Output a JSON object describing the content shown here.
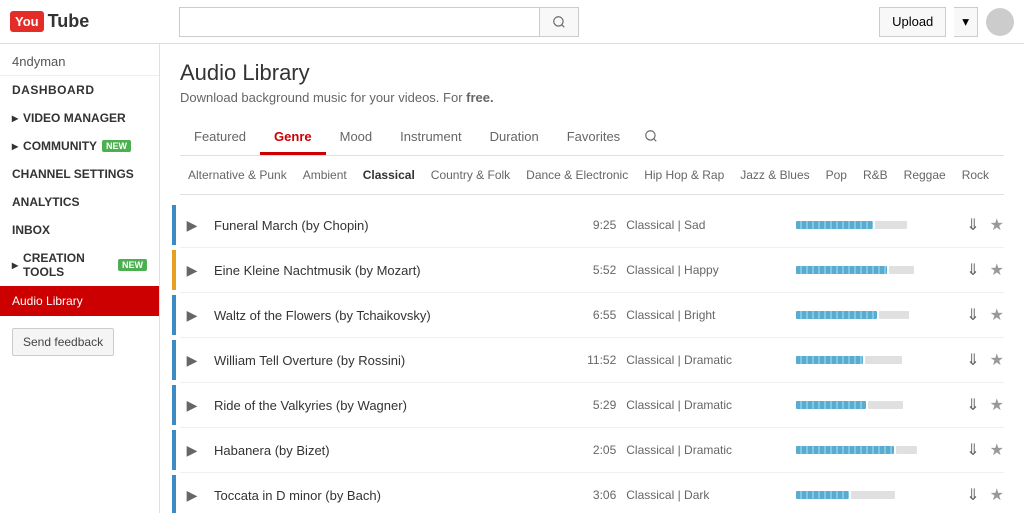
{
  "header": {
    "logo_box": "You",
    "logo_tube": "Tube",
    "search_placeholder": "",
    "upload_label": "Upload",
    "account_icon": "▾"
  },
  "sidebar": {
    "username": "4ndyman",
    "dashboard_label": "DASHBOARD",
    "items": [
      {
        "id": "video-manager",
        "label": "VIDEO MANAGER",
        "arrow": "▸"
      },
      {
        "id": "community",
        "label": "COMMUNITY",
        "badge": "NEW",
        "arrow": "▸"
      },
      {
        "id": "channel-settings",
        "label": "CHANNEL SETTINGS"
      },
      {
        "id": "analytics",
        "label": "ANALYTICS"
      },
      {
        "id": "inbox",
        "label": "INBOX"
      },
      {
        "id": "creation-tools",
        "label": "CREATION TOOLS",
        "badge": "NEW",
        "arrow": "▸"
      },
      {
        "id": "audio-library",
        "label": "Audio Library",
        "active": true
      }
    ],
    "feedback_label": "Send feedback"
  },
  "main": {
    "title": "Audio Library",
    "subtitle_text": "Download background music for your videos. For",
    "subtitle_free": "free.",
    "tabs_primary": [
      {
        "id": "featured",
        "label": "Featured"
      },
      {
        "id": "genre",
        "label": "Genre",
        "active": true
      },
      {
        "id": "mood",
        "label": "Mood"
      },
      {
        "id": "instrument",
        "label": "Instrument"
      },
      {
        "id": "duration",
        "label": "Duration"
      },
      {
        "id": "favorites",
        "label": "Favorites"
      }
    ],
    "genre_tabs": [
      {
        "id": "alt-punk",
        "label": "Alternative & Punk"
      },
      {
        "id": "ambient",
        "label": "Ambient"
      },
      {
        "id": "classical",
        "label": "Classical",
        "active": true
      },
      {
        "id": "country",
        "label": "Country & Folk"
      },
      {
        "id": "dance",
        "label": "Dance & Electronic"
      },
      {
        "id": "hiphop",
        "label": "Hip Hop & Rap"
      },
      {
        "id": "jazz",
        "label": "Jazz & Blues"
      },
      {
        "id": "pop",
        "label": "Pop"
      },
      {
        "id": "rnb",
        "label": "R&B"
      },
      {
        "id": "reggae",
        "label": "Reggae"
      },
      {
        "id": "rock",
        "label": "Rock"
      }
    ],
    "tracks": [
      {
        "id": 1,
        "title": "Funeral March (by Chopin)",
        "duration": "9:25",
        "genre": "Classical | Sad",
        "bar_pct": 55,
        "indicator": "blue",
        "starred": false
      },
      {
        "id": 2,
        "title": "Eine Kleine Nachtmusik (by Mozart)",
        "duration": "5:52",
        "genre": "Classical | Happy",
        "bar_pct": 65,
        "indicator": "orange",
        "starred": false
      },
      {
        "id": 3,
        "title": "Waltz of the Flowers (by Tchaikovsky)",
        "duration": "6:55",
        "genre": "Classical | Bright",
        "bar_pct": 58,
        "indicator": "blue",
        "starred": false
      },
      {
        "id": 4,
        "title": "William Tell Overture (by Rossini)",
        "duration": "11:52",
        "genre": "Classical | Dramatic",
        "bar_pct": 48,
        "indicator": "blue",
        "starred": false
      },
      {
        "id": 5,
        "title": "Ride of the Valkyries (by Wagner)",
        "duration": "5:29",
        "genre": "Classical | Dramatic",
        "bar_pct": 50,
        "indicator": "blue",
        "starred": false
      },
      {
        "id": 6,
        "title": "Habanera (by Bizet)",
        "duration": "2:05",
        "genre": "Classical | Dramatic",
        "bar_pct": 70,
        "indicator": "blue",
        "starred": false
      },
      {
        "id": 7,
        "title": "Toccata in D minor (by Bach)",
        "duration": "3:06",
        "genre": "Classical | Dark",
        "bar_pct": 38,
        "indicator": "blue",
        "starred": false
      }
    ]
  }
}
